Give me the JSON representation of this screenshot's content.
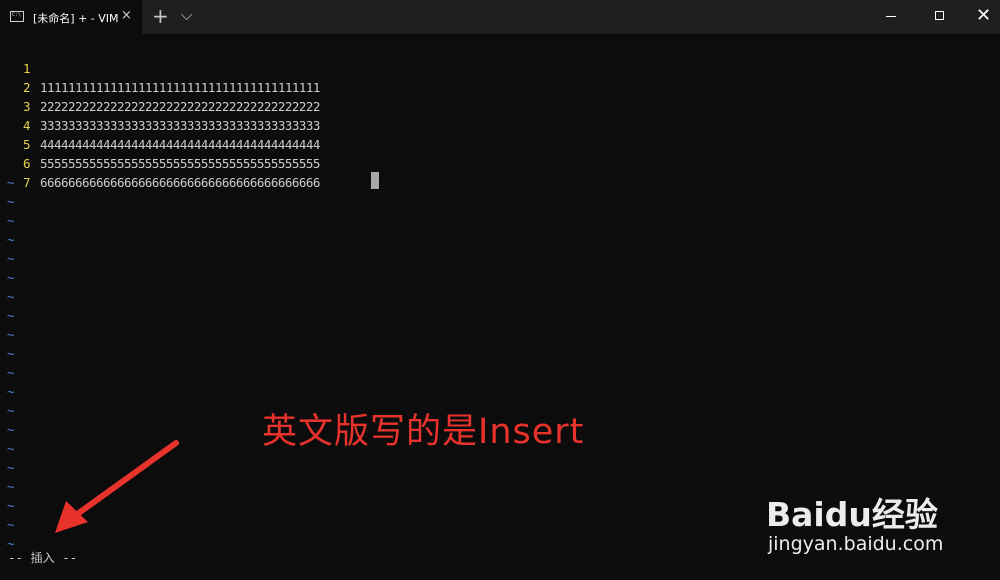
{
  "window": {
    "tab_title": "[未命名] + - VIM",
    "tab_close": "×",
    "new_tab": "+",
    "dropdown": "⌵",
    "close": "✕"
  },
  "editor": {
    "line_numbers": [
      "1",
      "2",
      "3",
      "4",
      "5",
      "6",
      "7"
    ],
    "lines": [
      "1111111111111111111111111111111111111111",
      "2222222222222222222222222222222222222222",
      "3333333333333333333333333333333333333333",
      "4444444444444444444444444444444444444444",
      "5555555555555555555555555555555555555555",
      "6666666666666666666666666666666666666666",
      ""
    ],
    "empty_marker": "~",
    "empty_count": 20
  },
  "statusline": {
    "mode_prefix": "-- ",
    "mode_label": "插入",
    "mode_suffix": " --"
  },
  "annotation": {
    "text": "英文版写的是Insert",
    "color": "#e8322c"
  },
  "watermark": {
    "brand": "Baidu经验",
    "url": "jingyan.baidu.com"
  },
  "colors": {
    "background": "#0c0c0c",
    "line_number": "#e6d24e",
    "tilde": "#4a7fd8"
  }
}
